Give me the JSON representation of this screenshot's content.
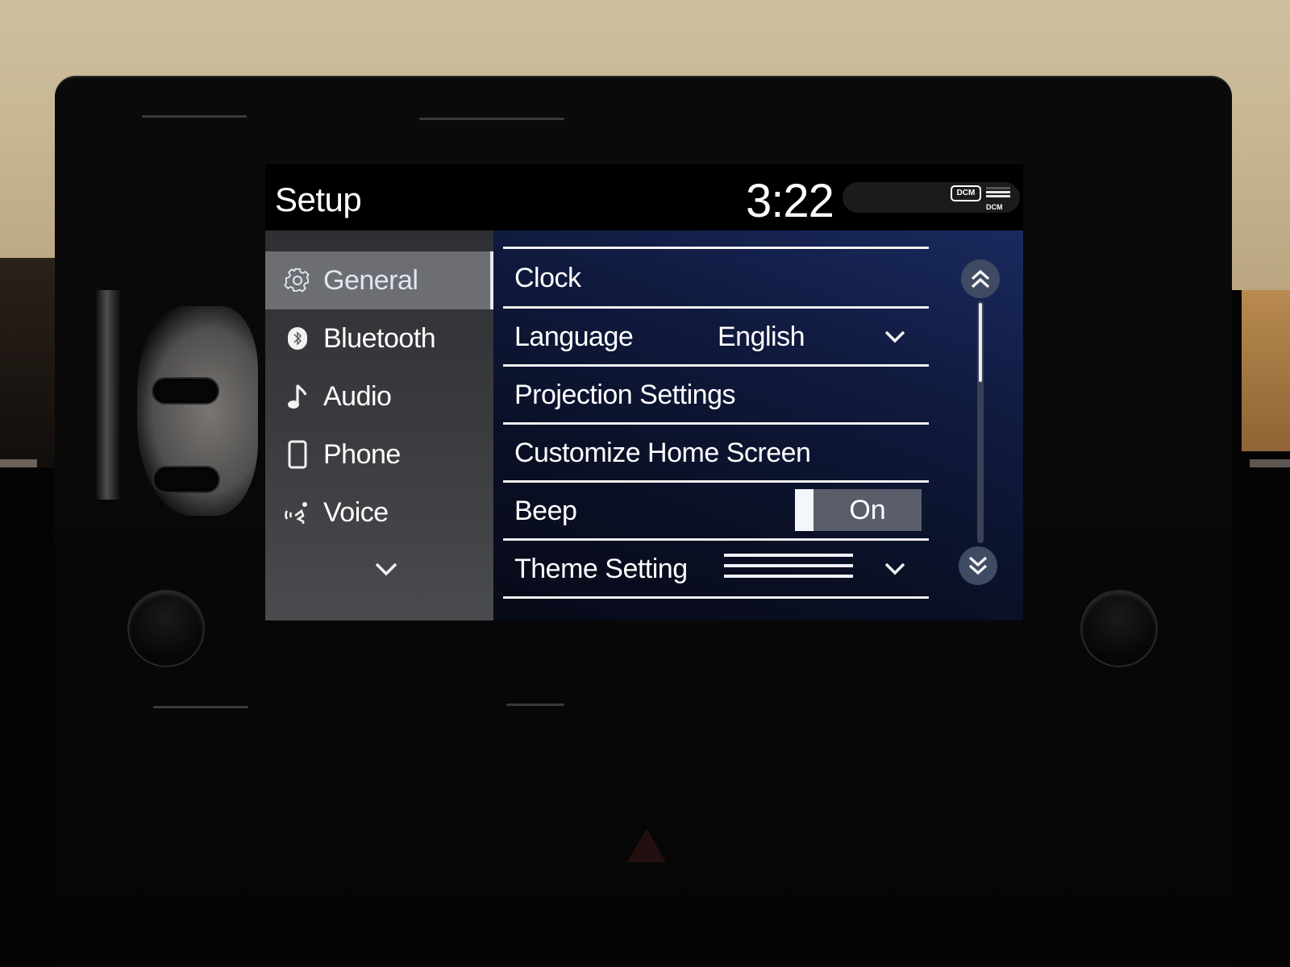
{
  "header": {
    "title": "Setup",
    "time": "3:22",
    "status": {
      "dcm_badge": "DCM",
      "signal_label": "DCM",
      "signal_icon": "cellular-signal-icon"
    }
  },
  "sidebar": {
    "items": [
      {
        "label": "General",
        "icon": "gear-icon",
        "active": true
      },
      {
        "label": "Bluetooth",
        "icon": "bluetooth-icon",
        "active": false
      },
      {
        "label": "Audio",
        "icon": "music-note-icon",
        "active": false
      },
      {
        "label": "Phone",
        "icon": "phone-icon",
        "active": false
      },
      {
        "label": "Voice",
        "icon": "voice-icon",
        "active": false
      }
    ],
    "more_icon": "chevron-down-icon"
  },
  "content": {
    "rows": [
      {
        "label": "Clock"
      },
      {
        "label": "Language",
        "value": "English",
        "control": "dropdown"
      },
      {
        "label": "Projection Settings"
      },
      {
        "label": "Customize Home Screen"
      },
      {
        "label": "Beep",
        "control": "toggle",
        "toggle_text": "On",
        "toggle_state": true
      },
      {
        "label": "Theme Setting",
        "control": "dropdown",
        "value_icon": "theme-lines-icon"
      }
    ],
    "scroll": {
      "up_icon": "double-chevron-up-icon",
      "down_icon": "double-chevron-down-icon",
      "position_fraction": 0.0,
      "visible_fraction": 0.33
    }
  },
  "colors": {
    "active_sidebar": "#6d6e71",
    "content_bg": "#101a3e",
    "toggle_bg": "#5a5e6b",
    "scroll_button": "#3f4a63"
  }
}
